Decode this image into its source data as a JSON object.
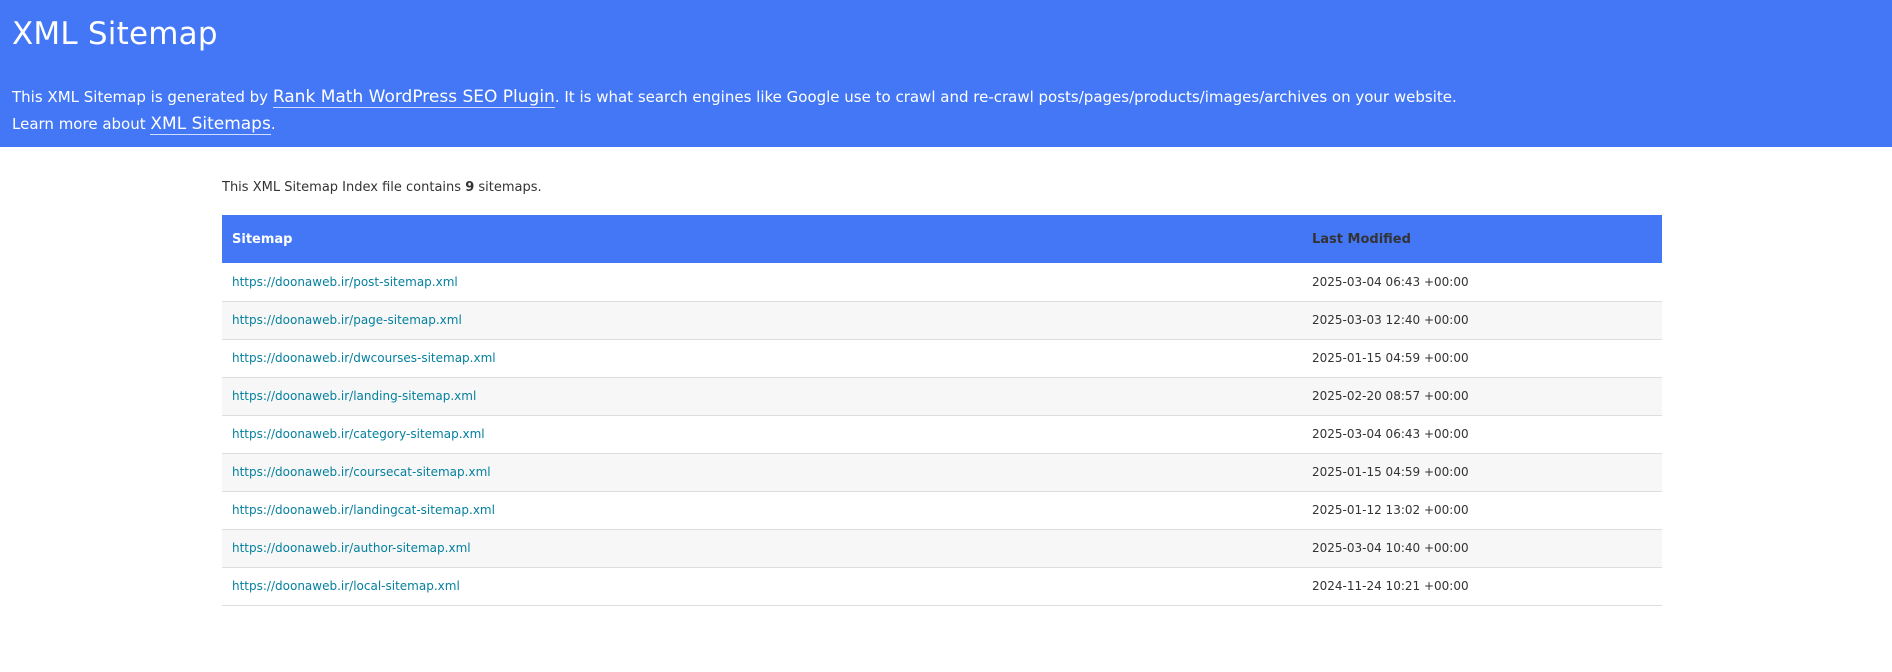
{
  "header": {
    "title": "XML Sitemap",
    "line1_prefix": "This XML Sitemap is generated by ",
    "plugin_link": "Rank Math WordPress SEO Plugin",
    "line1_suffix": ". It is what search engines like Google use to crawl and re-crawl posts/pages/products/images/archives on your website.",
    "line2_prefix": "Learn more about ",
    "sitemaps_link": "XML Sitemaps",
    "line2_suffix": "."
  },
  "intro": {
    "prefix": "This XML Sitemap Index file contains ",
    "count": "9",
    "suffix": " sitemaps."
  },
  "table": {
    "col_sitemap": "Sitemap",
    "col_lastmod": "Last Modified",
    "rows": [
      {
        "url": "https://doonaweb.ir/post-sitemap.xml",
        "lastmod": "2025-03-04 06:43 +00:00"
      },
      {
        "url": "https://doonaweb.ir/page-sitemap.xml",
        "lastmod": "2025-03-03 12:40 +00:00"
      },
      {
        "url": "https://doonaweb.ir/dwcourses-sitemap.xml",
        "lastmod": "2025-01-15 04:59 +00:00"
      },
      {
        "url": "https://doonaweb.ir/landing-sitemap.xml",
        "lastmod": "2025-02-20 08:57 +00:00"
      },
      {
        "url": "https://doonaweb.ir/category-sitemap.xml",
        "lastmod": "2025-03-04 06:43 +00:00"
      },
      {
        "url": "https://doonaweb.ir/coursecat-sitemap.xml",
        "lastmod": "2025-01-15 04:59 +00:00"
      },
      {
        "url": "https://doonaweb.ir/landingcat-sitemap.xml",
        "lastmod": "2025-01-12 13:02 +00:00"
      },
      {
        "url": "https://doonaweb.ir/author-sitemap.xml",
        "lastmod": "2025-03-04 10:40 +00:00"
      },
      {
        "url": "https://doonaweb.ir/local-sitemap.xml",
        "lastmod": "2024-11-24 10:21 +00:00"
      }
    ]
  },
  "colors": {
    "header_bg": "#4377f5",
    "link": "#05809e",
    "row_alt_bg": "#f7f7f7"
  }
}
